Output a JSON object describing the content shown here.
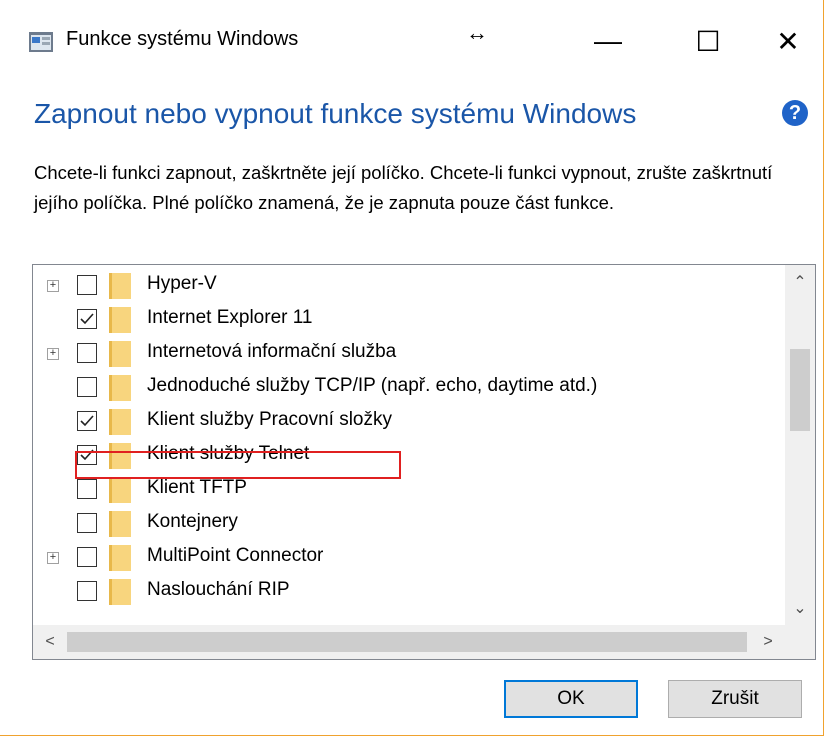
{
  "window": {
    "title": "Funkce systému Windows",
    "resize_glyph": "↔",
    "minimize_glyph": "—",
    "maximize_glyph": "☐",
    "close_glyph": "✕"
  },
  "heading": "Zapnout nebo vypnout funkce systému Windows",
  "help_glyph": "?",
  "description": "Chcete-li funkci zapnout, zaškrtněte její políčko. Chcete-li funkci vypnout, zrušte zaškrtnutí jejího políčka. Plné políčko znamená, že je zapnuta pouze část funkce.",
  "features": [
    {
      "label": "Hyper-V",
      "checked": false,
      "expandable": true
    },
    {
      "label": "Internet Explorer 11",
      "checked": true,
      "expandable": false
    },
    {
      "label": "Internetová informační služba",
      "checked": false,
      "expandable": true
    },
    {
      "label": "Jednoduché služby TCP/IP (např. echo, daytime atd.)",
      "checked": false,
      "expandable": false
    },
    {
      "label": "Klient služby Pracovní složky",
      "checked": true,
      "expandable": false
    },
    {
      "label": "Klient služby Telnet",
      "checked": true,
      "expandable": false,
      "highlighted": true
    },
    {
      "label": "Klient TFTP",
      "checked": false,
      "expandable": false
    },
    {
      "label": "Kontejnery",
      "checked": false,
      "expandable": false
    },
    {
      "label": "MultiPoint Connector",
      "checked": false,
      "expandable": true
    },
    {
      "label": "Naslouchání RIP",
      "checked": false,
      "expandable": false
    }
  ],
  "scroll": {
    "up": "⌃",
    "down": "⌄",
    "left": "<",
    "right": ">"
  },
  "buttons": {
    "ok": "OK",
    "cancel": "Zrušit"
  },
  "colors": {
    "heading": "#1a56a8",
    "highlight": "#e02020",
    "ok_border": "#0078d7",
    "window_border": "#f0a22e"
  }
}
